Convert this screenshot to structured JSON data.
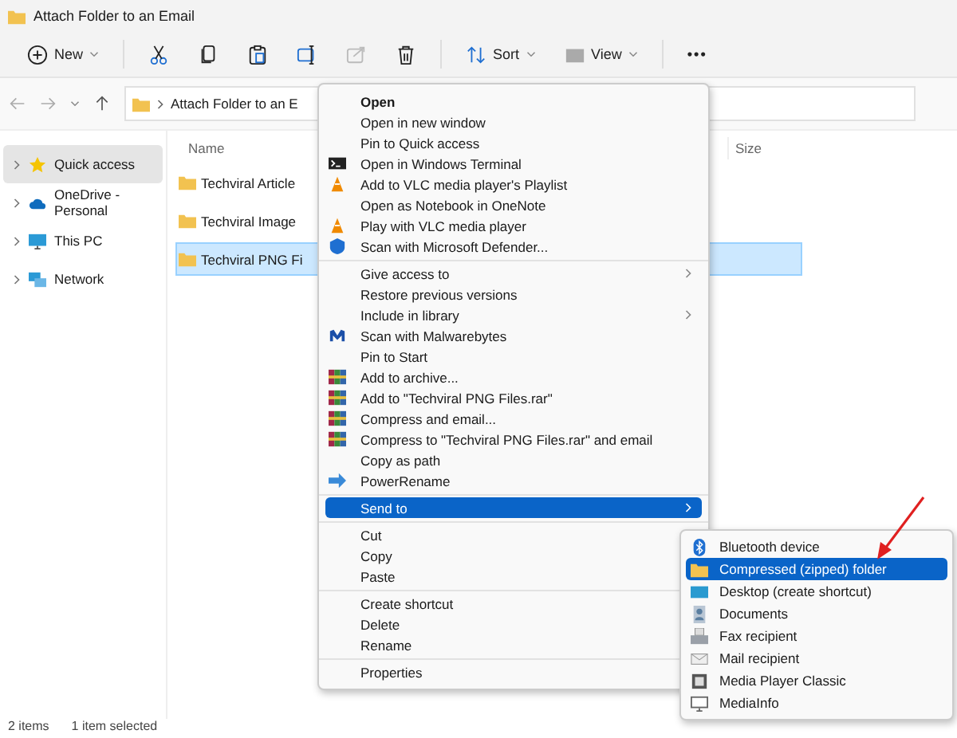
{
  "window": {
    "title": "Attach Folder to an Email"
  },
  "toolbar": [
    {
      "kind": "new",
      "label": "New",
      "disabled": false
    },
    {
      "kind": "divider"
    },
    {
      "kind": "cut",
      "disabled": false
    },
    {
      "kind": "copy",
      "disabled": false
    },
    {
      "kind": "paste",
      "disabled": false
    },
    {
      "kind": "rename",
      "disabled": false
    },
    {
      "kind": "share",
      "disabled": true
    },
    {
      "kind": "delete",
      "disabled": false
    },
    {
      "kind": "divider"
    },
    {
      "kind": "sort",
      "label": "Sort",
      "disabled": false
    },
    {
      "kind": "view",
      "label": "View",
      "disabled": false
    },
    {
      "kind": "divider"
    },
    {
      "kind": "more",
      "label": "•••",
      "disabled": false
    }
  ],
  "address_bar": {
    "path": "Attach Folder to an E"
  },
  "sidebar": {
    "items": [
      {
        "label": "Quick access",
        "selected": true
      },
      {
        "label": "OneDrive - Personal",
        "selected": false
      },
      {
        "label": "This PC",
        "selected": false
      },
      {
        "label": "Network",
        "selected": false
      }
    ]
  },
  "file_list": {
    "columns": [
      "Name",
      "Size"
    ],
    "rows": [
      {
        "name": "Techviral Article",
        "selected": false
      },
      {
        "name": "Techviral Image",
        "selected": false
      },
      {
        "name": "Techviral PNG Fi",
        "selected": true
      }
    ]
  },
  "status_bar": {
    "item_count": "2 items",
    "selection": "1 item selected"
  },
  "context_menu": {
    "items": [
      {
        "kind": "plain",
        "label": "Open",
        "bold": true,
        "selected": false
      },
      {
        "kind": "plain",
        "label": "Open in new window",
        "selected": false
      },
      {
        "kind": "plain",
        "label": "Pin to Quick access",
        "selected": false
      },
      {
        "kind": "terminal",
        "label": "Open in Windows Terminal",
        "selected": false
      },
      {
        "kind": "cone",
        "label": "Add to VLC media player's Playlist",
        "selected": false
      },
      {
        "kind": "plain",
        "label": "Open as Notebook in OneNote",
        "selected": false
      },
      {
        "kind": "cone",
        "label": "Play with VLC media player",
        "selected": false
      },
      {
        "kind": "shield",
        "label": "Scan with Microsoft Defender...",
        "selected": false
      },
      {
        "kind": "separator"
      },
      {
        "kind": "plain",
        "label": "Give access to",
        "submenu": true,
        "selected": false
      },
      {
        "kind": "plain",
        "label": "Restore previous versions",
        "selected": false
      },
      {
        "kind": "plain",
        "label": "Include in library",
        "submenu": true,
        "selected": false
      },
      {
        "kind": "malware",
        "label": "Scan with Malwarebytes",
        "selected": false
      },
      {
        "kind": "plain",
        "label": "Pin to Start",
        "selected": false
      },
      {
        "kind": "archive",
        "label": "Add to archive...",
        "selected": false
      },
      {
        "kind": "archive",
        "label": "Add to \"Techviral PNG Files.rar\"",
        "selected": false
      },
      {
        "kind": "archive",
        "label": "Compress and email...",
        "selected": false
      },
      {
        "kind": "archive",
        "label": "Compress to \"Techviral PNG Files.rar\" and email",
        "selected": false
      },
      {
        "kind": "plain",
        "label": "Copy as path",
        "selected": false
      },
      {
        "kind": "powerrename",
        "label": "PowerRename",
        "selected": false
      },
      {
        "kind": "separator"
      },
      {
        "kind": "plain",
        "label": "Send to",
        "submenu": true,
        "selected": true
      },
      {
        "kind": "separator"
      },
      {
        "kind": "plain",
        "label": "Cut",
        "selected": false
      },
      {
        "kind": "plain",
        "label": "Copy",
        "selected": false
      },
      {
        "kind": "plain",
        "label": "Paste",
        "selected": false
      },
      {
        "kind": "separator"
      },
      {
        "kind": "plain",
        "label": "Create shortcut",
        "selected": false
      },
      {
        "kind": "plain",
        "label": "Delete",
        "selected": false
      },
      {
        "kind": "plain",
        "label": "Rename",
        "selected": false
      },
      {
        "kind": "separator"
      },
      {
        "kind": "plain",
        "label": "Properties",
        "selected": false
      }
    ]
  },
  "send_to_menu": {
    "items": [
      {
        "kind": "bluetooth",
        "label": "Bluetooth device",
        "selected": false
      },
      {
        "kind": "folder",
        "label": "Compressed (zipped) folder",
        "selected": true
      },
      {
        "kind": "desktop",
        "label": "Desktop (create shortcut)",
        "selected": false
      },
      {
        "kind": "document",
        "label": "Documents",
        "selected": false
      },
      {
        "kind": "fax",
        "label": "Fax recipient",
        "selected": false
      },
      {
        "kind": "mail",
        "label": "Mail recipient",
        "selected": false
      },
      {
        "kind": "film",
        "label": "Media Player Classic",
        "selected": false
      },
      {
        "kind": "info-screen",
        "label": "MediaInfo",
        "selected": false
      }
    ]
  }
}
